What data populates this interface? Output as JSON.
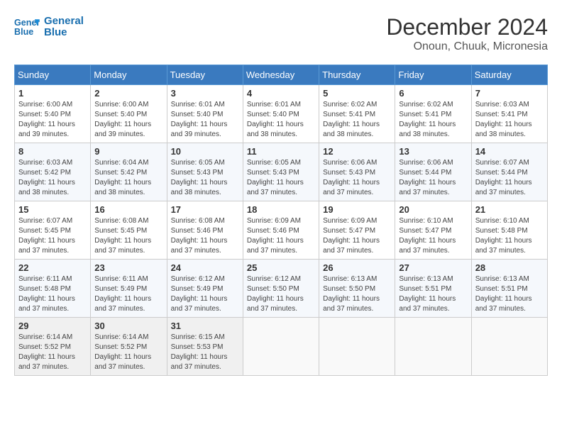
{
  "header": {
    "logo_line1": "General",
    "logo_line2": "Blue",
    "month": "December 2024",
    "location": "Onoun, Chuuk, Micronesia"
  },
  "weekdays": [
    "Sunday",
    "Monday",
    "Tuesday",
    "Wednesday",
    "Thursday",
    "Friday",
    "Saturday"
  ],
  "weeks": [
    [
      {
        "day": "1",
        "sunrise": "6:00 AM",
        "sunset": "5:40 PM",
        "daylight": "11 hours and 39 minutes."
      },
      {
        "day": "2",
        "sunrise": "6:00 AM",
        "sunset": "5:40 PM",
        "daylight": "11 hours and 39 minutes."
      },
      {
        "day": "3",
        "sunrise": "6:01 AM",
        "sunset": "5:40 PM",
        "daylight": "11 hours and 39 minutes."
      },
      {
        "day": "4",
        "sunrise": "6:01 AM",
        "sunset": "5:40 PM",
        "daylight": "11 hours and 38 minutes."
      },
      {
        "day": "5",
        "sunrise": "6:02 AM",
        "sunset": "5:41 PM",
        "daylight": "11 hours and 38 minutes."
      },
      {
        "day": "6",
        "sunrise": "6:02 AM",
        "sunset": "5:41 PM",
        "daylight": "11 hours and 38 minutes."
      },
      {
        "day": "7",
        "sunrise": "6:03 AM",
        "sunset": "5:41 PM",
        "daylight": "11 hours and 38 minutes."
      }
    ],
    [
      {
        "day": "8",
        "sunrise": "6:03 AM",
        "sunset": "5:42 PM",
        "daylight": "11 hours and 38 minutes."
      },
      {
        "day": "9",
        "sunrise": "6:04 AM",
        "sunset": "5:42 PM",
        "daylight": "11 hours and 38 minutes."
      },
      {
        "day": "10",
        "sunrise": "6:05 AM",
        "sunset": "5:43 PM",
        "daylight": "11 hours and 38 minutes."
      },
      {
        "day": "11",
        "sunrise": "6:05 AM",
        "sunset": "5:43 PM",
        "daylight": "11 hours and 37 minutes."
      },
      {
        "day": "12",
        "sunrise": "6:06 AM",
        "sunset": "5:43 PM",
        "daylight": "11 hours and 37 minutes."
      },
      {
        "day": "13",
        "sunrise": "6:06 AM",
        "sunset": "5:44 PM",
        "daylight": "11 hours and 37 minutes."
      },
      {
        "day": "14",
        "sunrise": "6:07 AM",
        "sunset": "5:44 PM",
        "daylight": "11 hours and 37 minutes."
      }
    ],
    [
      {
        "day": "15",
        "sunrise": "6:07 AM",
        "sunset": "5:45 PM",
        "daylight": "11 hours and 37 minutes."
      },
      {
        "day": "16",
        "sunrise": "6:08 AM",
        "sunset": "5:45 PM",
        "daylight": "11 hours and 37 minutes."
      },
      {
        "day": "17",
        "sunrise": "6:08 AM",
        "sunset": "5:46 PM",
        "daylight": "11 hours and 37 minutes."
      },
      {
        "day": "18",
        "sunrise": "6:09 AM",
        "sunset": "5:46 PM",
        "daylight": "11 hours and 37 minutes."
      },
      {
        "day": "19",
        "sunrise": "6:09 AM",
        "sunset": "5:47 PM",
        "daylight": "11 hours and 37 minutes."
      },
      {
        "day": "20",
        "sunrise": "6:10 AM",
        "sunset": "5:47 PM",
        "daylight": "11 hours and 37 minutes."
      },
      {
        "day": "21",
        "sunrise": "6:10 AM",
        "sunset": "5:48 PM",
        "daylight": "11 hours and 37 minutes."
      }
    ],
    [
      {
        "day": "22",
        "sunrise": "6:11 AM",
        "sunset": "5:48 PM",
        "daylight": "11 hours and 37 minutes."
      },
      {
        "day": "23",
        "sunrise": "6:11 AM",
        "sunset": "5:49 PM",
        "daylight": "11 hours and 37 minutes."
      },
      {
        "day": "24",
        "sunrise": "6:12 AM",
        "sunset": "5:49 PM",
        "daylight": "11 hours and 37 minutes."
      },
      {
        "day": "25",
        "sunrise": "6:12 AM",
        "sunset": "5:50 PM",
        "daylight": "11 hours and 37 minutes."
      },
      {
        "day": "26",
        "sunrise": "6:13 AM",
        "sunset": "5:50 PM",
        "daylight": "11 hours and 37 minutes."
      },
      {
        "day": "27",
        "sunrise": "6:13 AM",
        "sunset": "5:51 PM",
        "daylight": "11 hours and 37 minutes."
      },
      {
        "day": "28",
        "sunrise": "6:13 AM",
        "sunset": "5:51 PM",
        "daylight": "11 hours and 37 minutes."
      }
    ],
    [
      {
        "day": "29",
        "sunrise": "6:14 AM",
        "sunset": "5:52 PM",
        "daylight": "11 hours and 37 minutes."
      },
      {
        "day": "30",
        "sunrise": "6:14 AM",
        "sunset": "5:52 PM",
        "daylight": "11 hours and 37 minutes."
      },
      {
        "day": "31",
        "sunrise": "6:15 AM",
        "sunset": "5:53 PM",
        "daylight": "11 hours and 37 minutes."
      },
      null,
      null,
      null,
      null
    ]
  ]
}
